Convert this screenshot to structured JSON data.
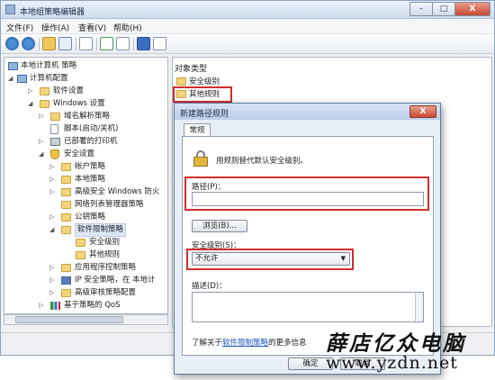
{
  "window": {
    "title": "本地组策略编辑器",
    "minimize": "–",
    "maximize": "□",
    "close": "X"
  },
  "menu": [
    "文件(F)",
    "操作(A)",
    "查看(V)",
    "帮助(H)"
  ],
  "toolbar": {
    "icons": [
      "back-icon",
      "forward-icon",
      "up-folder-icon",
      "show-tree-icon",
      "properties-icon",
      "refresh-icon",
      "export-icon",
      "help-icon",
      "view-icon"
    ]
  },
  "tree": {
    "items": [
      {
        "label": "本地计算机 策略",
        "icon": "computer-policy"
      },
      {
        "label": "计算机配置",
        "icon": "computer"
      },
      {
        "label": "软件设置",
        "icon": "folder"
      },
      {
        "label": "Windows 设置",
        "icon": "folder"
      },
      {
        "label": "域名解析策略",
        "icon": "folder"
      },
      {
        "label": "脚本(启动/关机)",
        "icon": "script"
      },
      {
        "label": "已部署的打印机",
        "icon": "printer"
      },
      {
        "label": "安全设置",
        "icon": "shield"
      },
      {
        "label": "帐户策略",
        "icon": "folder"
      },
      {
        "label": "本地策略",
        "icon": "folder"
      },
      {
        "label": "高级安全 Windows 防火",
        "icon": "folder"
      },
      {
        "label": "网络列表管理器策略",
        "icon": "folder"
      },
      {
        "label": "公钥策略",
        "icon": "folder"
      },
      {
        "label": "软件限制策略",
        "icon": "folder"
      },
      {
        "label": "安全级别",
        "icon": "folder"
      },
      {
        "label": "其他规则",
        "icon": "folder"
      },
      {
        "label": "应用程序控制策略",
        "icon": "folder"
      },
      {
        "label": "IP 安全策略，在 本地计",
        "icon": "ip-security"
      },
      {
        "label": "高级审核策略配置",
        "icon": "folder"
      },
      {
        "label": "基于策略的 QoS",
        "icon": "chart"
      }
    ]
  },
  "right": {
    "column_header": "对象类型",
    "items": [
      "安全级别",
      "其他规则"
    ]
  },
  "dialog": {
    "title": "新建路径规则",
    "close": "X",
    "tab": "常规",
    "description": "用规则替代默认安全级别。",
    "path_label": "路径(P)：",
    "path_value": "",
    "browse_button": "浏览(B)...",
    "security_label": "安全级别(S)：",
    "security_value": "不允许",
    "desc_label": "描述(D)：",
    "desc_value": "",
    "footer_prefix": "了解关于",
    "footer_link": "软件限制策略",
    "footer_suffix": "的更多信息",
    "ok_button": "确定",
    "cancel_button": "取消"
  },
  "watermark": {
    "brand": "薛店亿众电脑",
    "url": "www.yzdn.net"
  },
  "colors": {
    "highlight_box": "#d22c2c",
    "link": "#1b55c8",
    "selection": "#dde8f7"
  }
}
